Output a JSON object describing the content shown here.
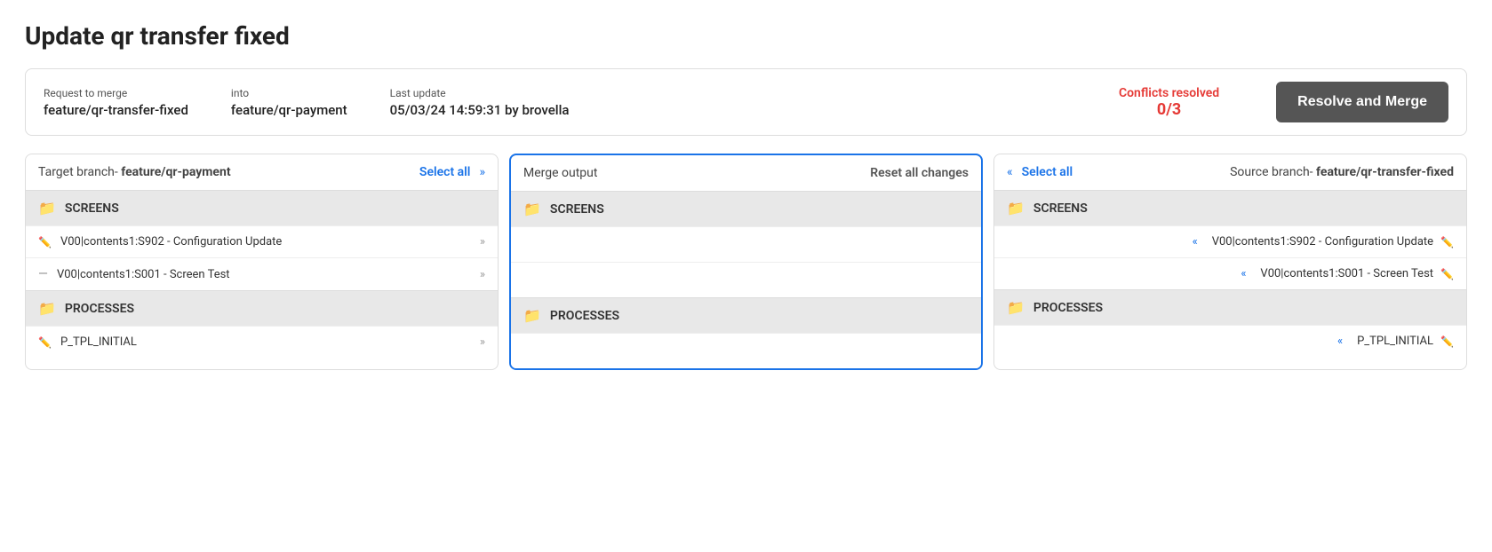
{
  "page": {
    "title": "Update qr transfer fixed"
  },
  "meta": {
    "request_to_merge_label": "Request to merge",
    "request_to_merge_value": "feature/qr-transfer-fixed",
    "into_label": "into",
    "into_value": "feature/qr-payment",
    "last_update_label": "Last update",
    "last_update_value": "05/03/24 14:59:31 by brovella",
    "conflicts_resolved_label": "Conflicts resolved",
    "conflicts_resolved_count": "0/3",
    "resolve_button": "Resolve and Merge"
  },
  "target": {
    "header_prefix": "Target branch- ",
    "branch_name": "feature/qr-payment",
    "select_all": "Select all",
    "chevrons": "»",
    "rows": [
      {
        "type": "folder",
        "label": "SCREENS"
      },
      {
        "type": "file",
        "icon": "edit",
        "label": "V00|contents1:S902 - Configuration Update"
      },
      {
        "type": "file",
        "icon": "dash",
        "label": "V00|contents1:S001 - Screen Test"
      },
      {
        "type": "folder",
        "label": "PROCESSES"
      },
      {
        "type": "file",
        "icon": "edit",
        "label": "P_TPL_INITIAL"
      }
    ]
  },
  "center": {
    "header": "Merge output",
    "reset": "Reset all changes",
    "rows": [
      {
        "type": "folder",
        "label": "SCREENS"
      },
      {
        "type": "empty"
      },
      {
        "type": "empty"
      },
      {
        "type": "folder",
        "label": "PROCESSES"
      },
      {
        "type": "empty"
      }
    ]
  },
  "source": {
    "header_prefix": "Source branch- ",
    "branch_name": "feature/qr-transfer-fixed",
    "select_all": "Select all",
    "chevrons_left": "«",
    "rows": [
      {
        "type": "folder",
        "label": "SCREENS"
      },
      {
        "type": "file",
        "label": "V00|contents1:S902 - Configuration Update"
      },
      {
        "type": "file",
        "label": "V00|contents1:S001 - Screen Test"
      },
      {
        "type": "folder",
        "label": "PROCESSES"
      },
      {
        "type": "file",
        "label": "P_TPL_INITIAL"
      }
    ]
  }
}
